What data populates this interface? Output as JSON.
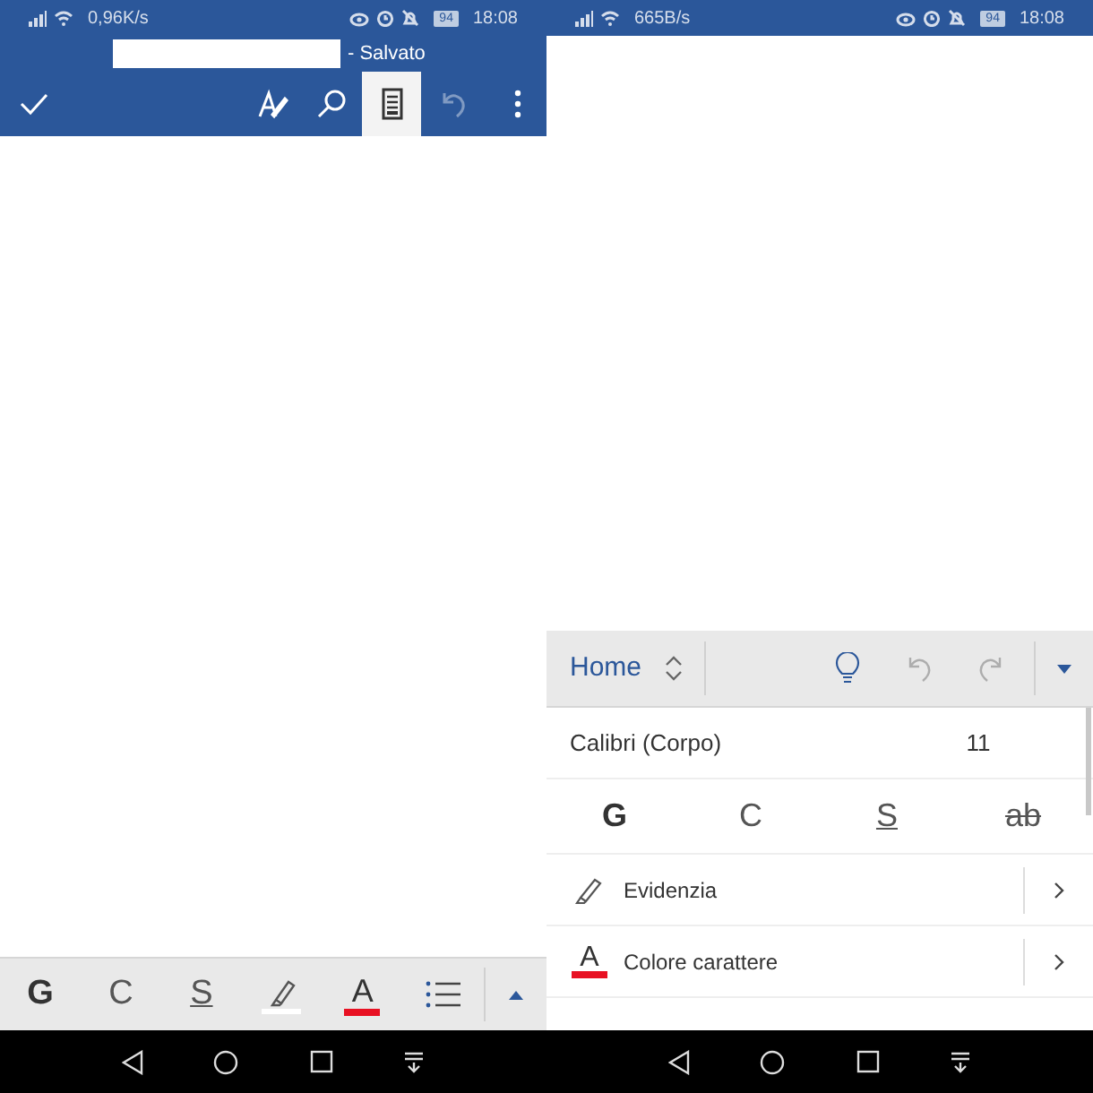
{
  "left": {
    "status_bar": {
      "speed": "0,96K/s",
      "battery": "94",
      "time": "18:08"
    },
    "title": {
      "suffix": "- Salvato"
    },
    "toolbar": [
      {
        "kind": "done",
        "selected": false,
        "disabled": false
      },
      {
        "kind": "draw",
        "selected": false,
        "disabled": false
      },
      {
        "kind": "search",
        "selected": false,
        "disabled": false
      },
      {
        "kind": "layout",
        "selected": true,
        "disabled": false
      },
      {
        "kind": "undo",
        "selected": false,
        "disabled": true
      },
      {
        "kind": "more",
        "selected": false,
        "disabled": false
      }
    ],
    "format_bar": [
      {
        "kind": "bold",
        "label": "G"
      },
      {
        "kind": "italic",
        "label": "C"
      },
      {
        "kind": "underline",
        "label": "S"
      },
      {
        "kind": "highlight",
        "color": "#ffffff"
      },
      {
        "kind": "font_color",
        "label": "A",
        "color": "#e81123"
      },
      {
        "kind": "list"
      },
      {
        "kind": "expand"
      }
    ]
  },
  "right": {
    "status_bar": {
      "speed": "665B/s",
      "battery": "94",
      "time": "18:08"
    },
    "ribbon": {
      "tab": "Home",
      "undo_disabled": true,
      "redo_disabled": true
    },
    "font": {
      "name": "Calibri (Corpo)",
      "size": "11"
    },
    "styles": [
      {
        "kind": "bold",
        "label": "G"
      },
      {
        "kind": "italic",
        "label": "C"
      },
      {
        "kind": "underline",
        "label": "S"
      },
      {
        "kind": "strike",
        "label": "ab"
      }
    ],
    "rows": [
      {
        "kind": "highlight",
        "label": "Evidenzia"
      },
      {
        "kind": "font_color",
        "icon_label": "A",
        "label": "Colore carattere",
        "color": "#e81123"
      }
    ]
  }
}
